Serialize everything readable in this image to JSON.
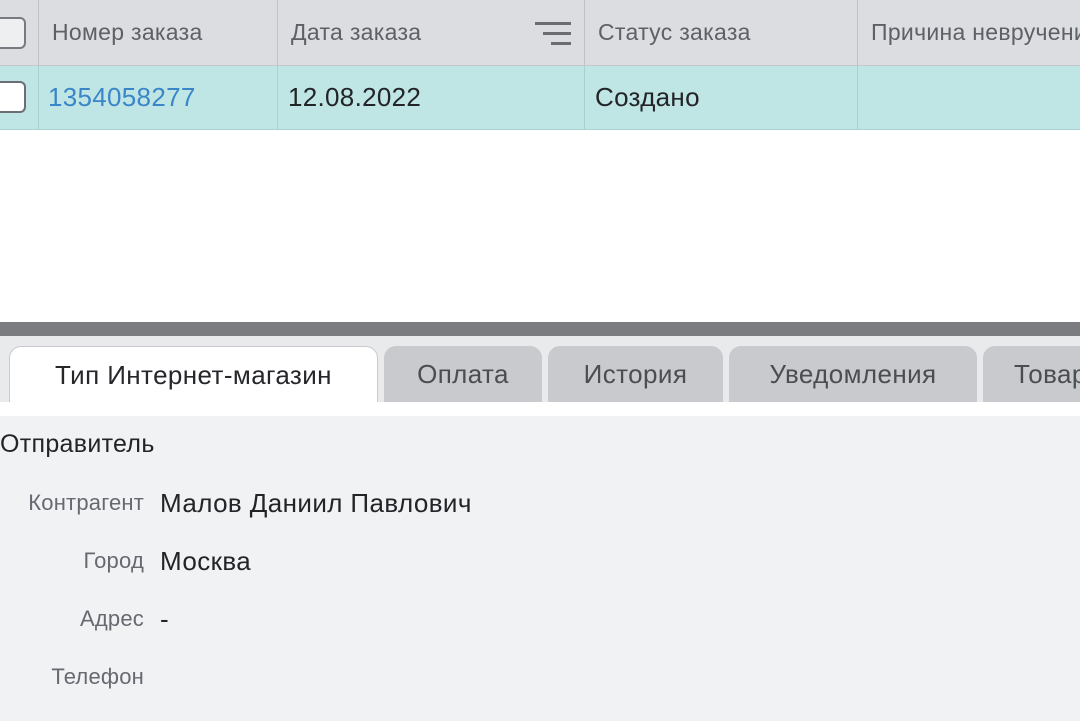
{
  "grid": {
    "columns": [
      {
        "label": "Номер заказа"
      },
      {
        "label": "Дата заказа"
      },
      {
        "label": "Статус заказа"
      },
      {
        "label": "Причина невручения"
      }
    ],
    "rows": [
      {
        "order_number": "1354058277",
        "order_date": "12.08.2022",
        "order_status": "Создано",
        "nondelivery_reason": ""
      }
    ]
  },
  "tabs": [
    {
      "label": "Тип Интернет-магазин",
      "active": true
    },
    {
      "label": "Оплата",
      "active": false
    },
    {
      "label": "История",
      "active": false
    },
    {
      "label": "Уведомления",
      "active": false
    },
    {
      "label": "Товары",
      "active": false
    }
  ],
  "details": {
    "section_title": "Отправитель",
    "fields": [
      {
        "label": "Контрагент",
        "value": "Малов Даниил Павлович"
      },
      {
        "label": "Город",
        "value": "Москва"
      },
      {
        "label": "Адрес",
        "value": "-"
      },
      {
        "label": "Телефон",
        "value": ""
      }
    ]
  },
  "colors": {
    "selected_row": "#bfe6e4",
    "link": "#3a86c8",
    "header_bg": "#dcdde0",
    "details_bg": "#f1f2f4"
  },
  "icons": {
    "filter": "filter-lines-icon",
    "checkbox": "checkbox-icon"
  }
}
